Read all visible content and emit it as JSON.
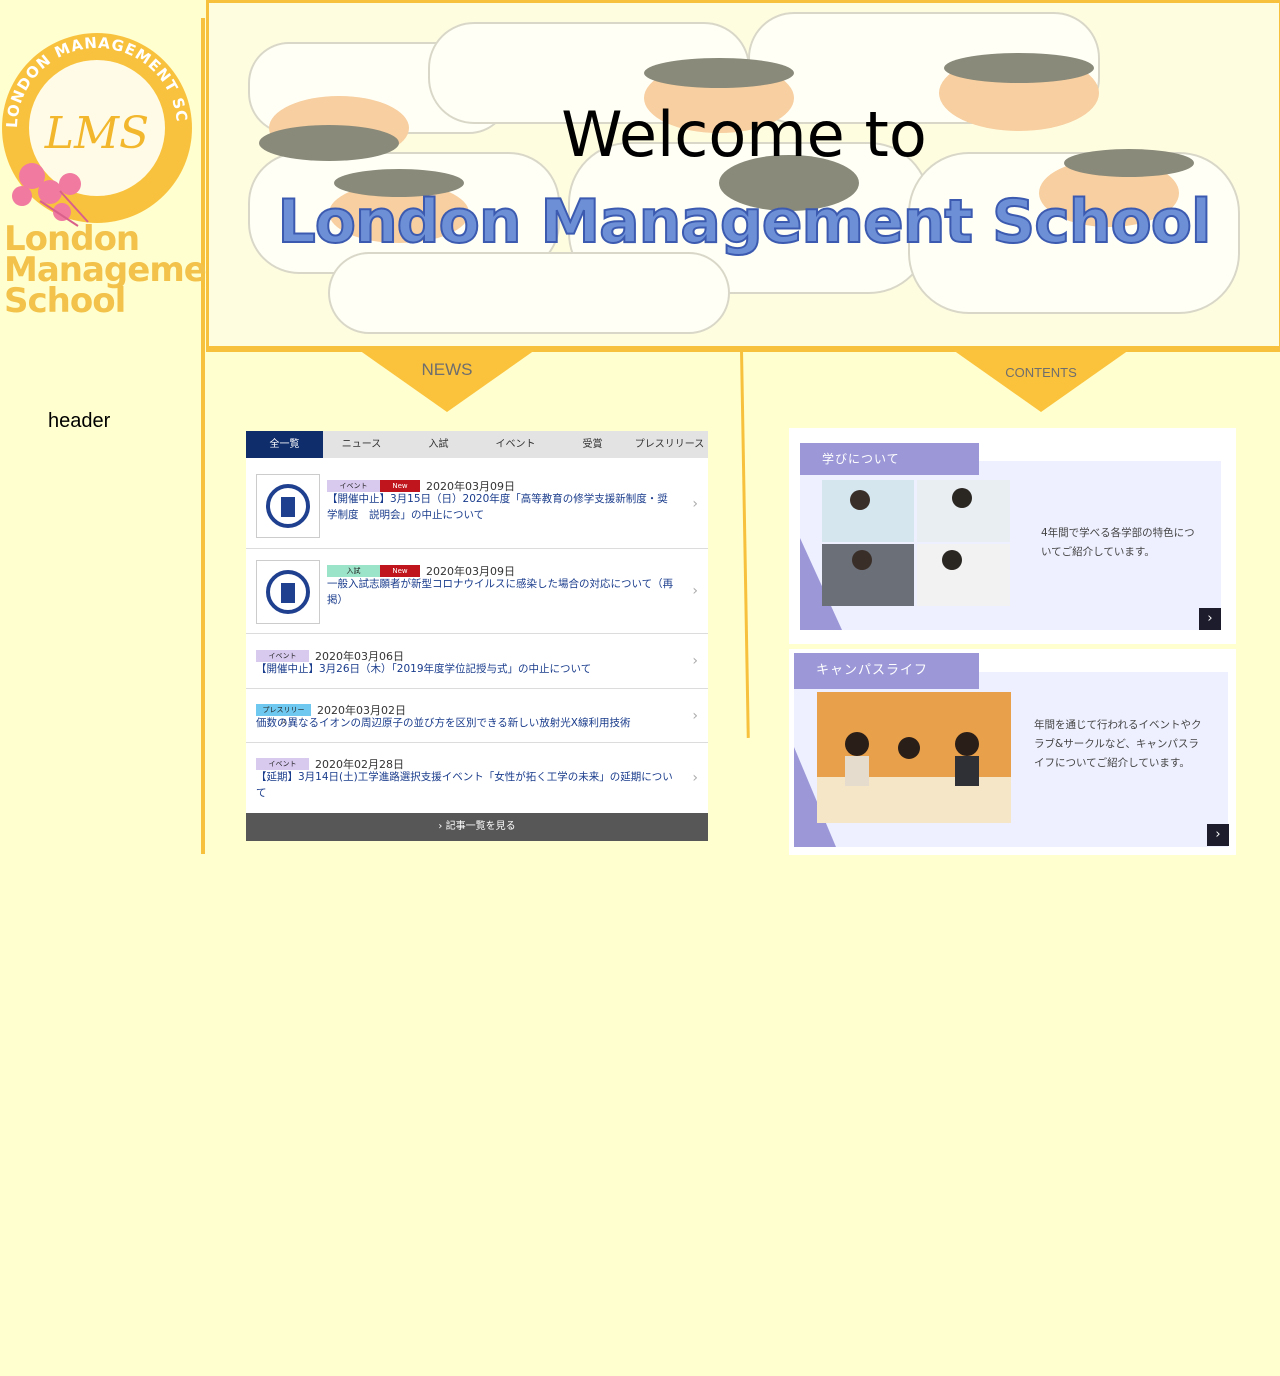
{
  "logo": {
    "ring_text": "LONDON MANAGEMENT SCHOOL",
    "monogram": "LMS",
    "wordmark": [
      "London",
      "Management",
      "School"
    ]
  },
  "header_label": "header",
  "hero": {
    "line1": "Welcome to",
    "line2": "London Management School"
  },
  "sections": {
    "news_label": "NEWS",
    "contents_label": "CONTENTS"
  },
  "news": {
    "tabs": [
      "全一覧",
      "ニュース",
      "入試",
      "イベント",
      "受賞",
      "プレスリリース"
    ],
    "active_tab": "全一覧",
    "items": [
      {
        "badges": [
          "イベント",
          "New"
        ],
        "date": "2020年03月09日",
        "title": "【開催中止】3月15日（日）2020年度「高等教育の修学支援新制度・奨学制度　説明会」の中止について"
      },
      {
        "badges": [
          "入試",
          "New"
        ],
        "date": "2020年03月09日",
        "title": "一般入試志願者が新型コロナウイルスに感染した場合の対応について（再掲）"
      },
      {
        "badges": [
          "イベント"
        ],
        "date": "2020年03月06日",
        "title": "【開催中止】3月26日（木）「2019年度学位記授与式」の中止について"
      },
      {
        "badges": [
          "プレスリリース"
        ],
        "date": "2020年03月02日",
        "title": "価数の異なるイオンの周辺原子の並び方を区別できる新しい放射光X線利用技術"
      },
      {
        "badges": [
          "イベント"
        ],
        "date": "2020年02月28日",
        "title": "【延期】3月14日(土)工学進路選択支援イベント「女性が拓く工学の未来」の延期について"
      }
    ],
    "footer_link": "› 記事一覧を見る"
  },
  "contents": {
    "cards": [
      {
        "heading": "学びについて",
        "description": "4年間で学べる各学部の特色についてご紹介しています。",
        "button": "›"
      },
      {
        "heading": "キャンパスライフ",
        "description": "年間を通じて行われるイベントやクラブ&サークルなど、キャンパスライフについてご紹介しています。",
        "button": "›"
      }
    ]
  },
  "colors": {
    "page_bg": "#ffffcf",
    "accent_yellow": "#f7c13e",
    "hero_title_blue": "#6d8fd6",
    "news_active_tab": "#0f2c6b",
    "badge_event": "#d8c9ef",
    "badge_new": "#c0151c",
    "badge_exam": "#9be3c9",
    "badge_press": "#6fc8ef",
    "card_header": "#9c98d8"
  }
}
